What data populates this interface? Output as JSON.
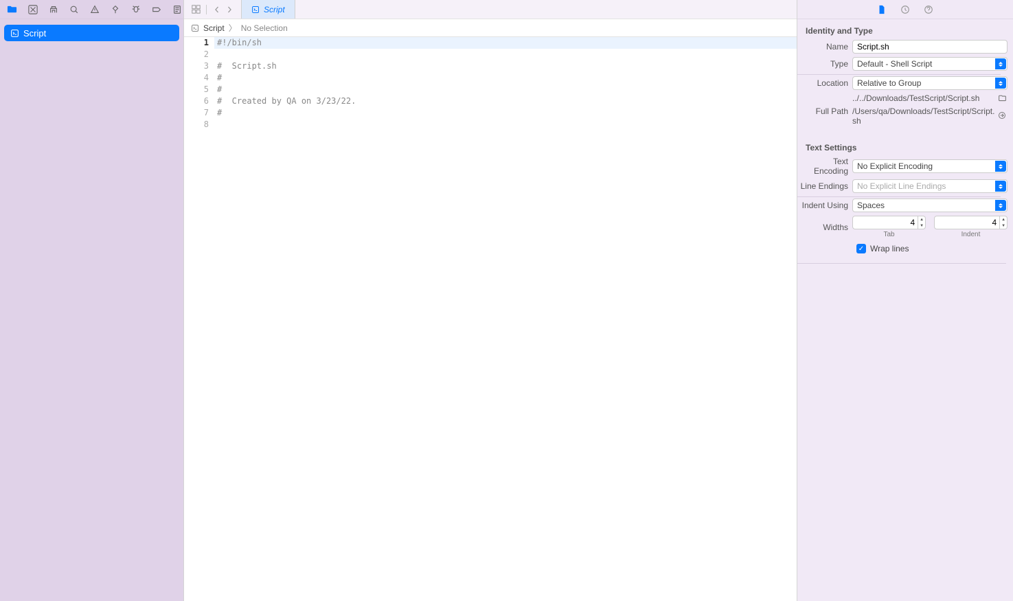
{
  "navigator": {
    "selected_item": "Script"
  },
  "editor": {
    "tab_label": "Script",
    "jumpbar": {
      "item1": "Script",
      "item2": "No Selection"
    },
    "code_lines": [
      "#!/bin/sh",
      "",
      "#  Script.sh",
      "#",
      "#",
      "#  Created by QA on 3/23/22.",
      "#",
      ""
    ]
  },
  "inspector": {
    "section_identity_title": "Identity and Type",
    "section_text_title": "Text Settings",
    "labels": {
      "name": "Name",
      "type": "Type",
      "location": "Location",
      "full_path": "Full Path",
      "text_encoding": "Text Encoding",
      "line_endings": "Line Endings",
      "indent_using": "Indent Using",
      "widths": "Widths",
      "tab": "Tab",
      "indent": "Indent",
      "wrap_lines": "Wrap lines"
    },
    "values": {
      "name": "Script.sh",
      "type": "Default - Shell Script",
      "location": "Relative to Group",
      "location_path": "../../Downloads/TestScript/Script.sh",
      "full_path": "/Users/qa/Downloads/TestScript/Script.sh",
      "text_encoding": "No Explicit Encoding",
      "line_endings_placeholder": "No Explicit Line Endings",
      "indent_using": "Spaces",
      "tab_width": "4",
      "indent_width": "4",
      "wrap_lines_checked": true
    }
  }
}
